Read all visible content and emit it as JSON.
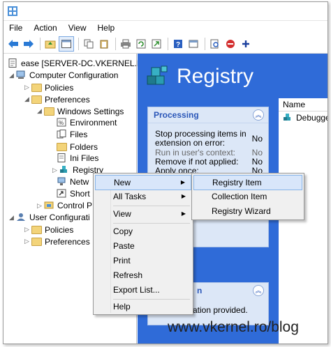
{
  "menubar": [
    "File",
    "Action",
    "View",
    "Help"
  ],
  "tree": {
    "root": "ease [SERVER-DC.VKERNEL.LOC",
    "computer_config": "Computer Configuration",
    "policies": "Policies",
    "preferences": "Preferences",
    "windows_settings": "Windows Settings",
    "environment": "Environment",
    "files": "Files",
    "folders": "Folders",
    "ini_files": "Ini Files",
    "registry": "Registry",
    "network_shares": "Netw",
    "shortcuts": "Short",
    "control_panel": "Control P",
    "user_config": "User Configurati",
    "user_policies": "Policies",
    "user_preferences": "Preferences"
  },
  "header": {
    "title": "Registry"
  },
  "processing": {
    "title": "Processing",
    "rows": [
      {
        "label_l1": "Stop processing items in",
        "label_l2": "extension on error:",
        "value": "No"
      },
      {
        "label": "Run in user's context:",
        "value": "No"
      },
      {
        "label": "Remove if not applied:",
        "value": "No"
      },
      {
        "label": "Apply once:",
        "value": "No"
      }
    ]
  },
  "panel2": {
    "title": "n",
    "text": "ation provided."
  },
  "list": {
    "column": "Name",
    "rows": [
      "Debugge"
    ]
  },
  "context_menu": {
    "new": "New",
    "all_tasks": "All Tasks",
    "view": "View",
    "copy": "Copy",
    "paste": "Paste",
    "print": "Print",
    "refresh": "Refresh",
    "export": "Export List...",
    "help": "Help"
  },
  "submenu": {
    "registry_item": "Registry Item",
    "collection_item": "Collection Item",
    "registry_wizard": "Registry Wizard"
  },
  "watermark": "www.vkernel.ro/blog",
  "colors": {
    "accent": "#2f6bd8",
    "highlight": "#d8e6fa"
  }
}
